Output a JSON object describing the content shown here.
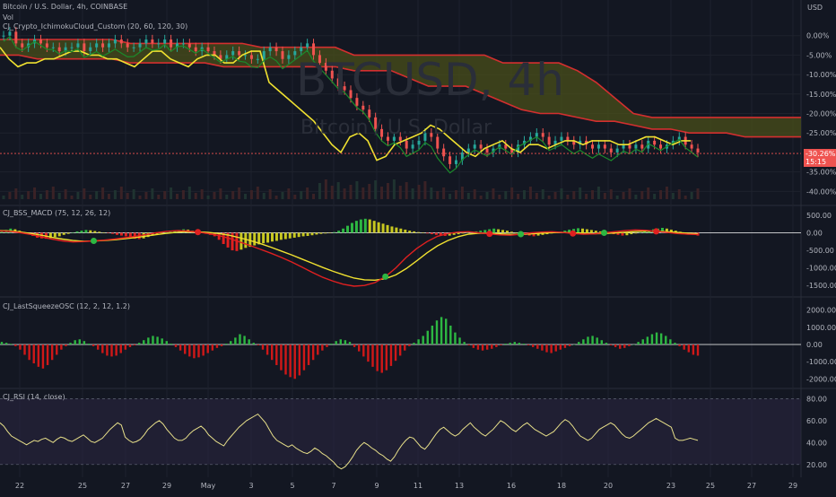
{
  "header": {
    "symbol": "Bitcoin / U.S. Dollar, 4h, COINBASE",
    "vol": "Vol",
    "ichimoku": "CJ_Crypto_IchimokuCloud_Custom (20, 60, 120, 30)",
    "macd": "CJ_BSS_MACD (75, 12, 26, 12)",
    "squeeze": "CJ_LastSqueezeOSC (12, 2, 12, 1.2)",
    "rsi": "CJ_RSI (14, close)"
  },
  "watermark": {
    "main": "BTCUSD, 4h",
    "sub": "Bitcoin / U.S. Dollar"
  },
  "currency_label": "USD",
  "last_price": {
    "value": "-30.26%",
    "timer": "15:15",
    "color": "#ef5350"
  },
  "colors": {
    "bg": "#131722",
    "grid": "#1e222d",
    "up": "#26a69a",
    "down": "#ef5350",
    "cloud": "#4a4f1a",
    "cloud_edge": "#d32f2f",
    "yellow": "#f0e130",
    "green": "#2db742",
    "red": "#e02020",
    "rsi_band": "#2a2540"
  },
  "chart_data": [
    {
      "type": "line",
      "title": "Bitcoin / U.S. Dollar, 4h, COINBASE",
      "x_ticks": [
        "22",
        "25",
        "27",
        "29",
        "May",
        "3",
        "5",
        "7",
        "9",
        "11",
        "13",
        "16",
        "18",
        "20",
        "23",
        "25",
        "27",
        "29"
      ],
      "y_unit": "%",
      "y_ticks": [
        "0.00%",
        "-5.00%",
        "-10.00%",
        "-15.00%",
        "-20.00%",
        "-25.00%",
        "-35.00%",
        "-40.00%"
      ],
      "ylim": [
        -42,
        5
      ],
      "series": [
        {
          "role": "price_close",
          "values": [
            0,
            1,
            -2,
            -3,
            -2,
            -1,
            -2,
            -3,
            -3,
            -4,
            -3,
            -3,
            -2,
            -4,
            -3,
            -2,
            -3,
            -2,
            -1,
            -2,
            -3,
            -3,
            -2,
            -1,
            -2,
            -2,
            -1,
            -3,
            -2,
            -2,
            -3,
            -4,
            -3,
            -4,
            -5,
            -6,
            -5,
            -4,
            -5,
            -5,
            -6,
            -6,
            -4,
            -3,
            -4,
            -6,
            -5,
            -4,
            -3,
            -2,
            -5,
            -7,
            -9,
            -11,
            -13,
            -14,
            -16,
            -18,
            -19,
            -21,
            -24,
            -26,
            -27,
            -26,
            -27,
            -29,
            -28,
            -27,
            -25,
            -26,
            -29,
            -31,
            -33,
            -32,
            -30,
            -29,
            -28,
            -29,
            -30,
            -29,
            -28,
            -29,
            -30,
            -28,
            -27,
            -26,
            -25,
            -26,
            -28,
            -27,
            -26,
            -27,
            -28,
            -27,
            -28,
            -29,
            -28,
            -29,
            -30,
            -29,
            -28,
            -29,
            -28,
            -29,
            -27,
            -28,
            -29,
            -28,
            -27,
            -26,
            -28,
            -29,
            -30
          ]
        },
        {
          "role": "lagging_yellow",
          "values": [
            -3,
            -6,
            -8,
            -7,
            -7,
            -6,
            -6,
            -5,
            -4,
            -4,
            -5,
            -5,
            -6,
            -6,
            -7,
            -8,
            -6,
            -4,
            -4,
            -6,
            -7,
            -8,
            -6,
            -5,
            -5,
            -7,
            -7,
            -5,
            -4,
            -4,
            -12,
            -14,
            -16,
            -18,
            -20,
            -22,
            -25,
            -28,
            -30,
            -26,
            -25,
            -27,
            -32,
            -31,
            -28,
            -27,
            -26,
            -25,
            -23,
            -24,
            -26,
            -28,
            -30,
            -31,
            -29,
            -28,
            -27,
            -29,
            -30,
            -28,
            -28,
            -29,
            -28,
            -27,
            -27,
            -28,
            -27,
            -27,
            -27,
            -28,
            -28,
            -27,
            -26,
            -26,
            -27,
            -28,
            -27,
            -27
          ]
        },
        {
          "role": "cloud_upper",
          "values": [
            -1,
            -1,
            -1,
            -1,
            -1,
            -1,
            -1,
            -2,
            -2,
            -2,
            -2,
            -2,
            -2,
            -2,
            -3,
            -3,
            -3,
            -3,
            -3,
            -5,
            -5,
            -5,
            -5,
            -5,
            -5,
            -5,
            -5,
            -7,
            -7,
            -7,
            -7,
            -9,
            -12,
            -16,
            -20,
            -21,
            -21,
            -21,
            -21,
            -21,
            -21,
            -21,
            -21,
            -21
          ]
        },
        {
          "role": "cloud_lower",
          "values": [
            -5,
            -5,
            -6,
            -6,
            -6,
            -6,
            -6,
            -7,
            -7,
            -7,
            -7,
            -7,
            -8,
            -8,
            -8,
            -8,
            -8,
            -8,
            -8,
            -9,
            -9,
            -9,
            -11,
            -13,
            -13,
            -13,
            -15,
            -17,
            -19,
            -20,
            -20,
            -21,
            -22,
            -22,
            -23,
            -24,
            -24,
            -25,
            -25,
            -25,
            -26,
            -26,
            -26,
            -26
          ]
        }
      ]
    },
    {
      "type": "bar",
      "title": "CJ_BSS_MACD (75, 12, 26, 12)",
      "y_ticks": [
        "500.00",
        "0.00",
        "-500.00",
        "-1000.00",
        "-1500.00"
      ],
      "ylim": [
        -1700,
        600
      ],
      "histogram": [
        50,
        80,
        120,
        100,
        60,
        20,
        -40,
        -90,
        -140,
        -160,
        -170,
        -150,
        -120,
        -100,
        -60,
        -30,
        10,
        40,
        60,
        80,
        70,
        50,
        30,
        10,
        -10,
        -30,
        -60,
        -80,
        -100,
        -140,
        -170,
        -180,
        -160,
        -120,
        -80,
        -40,
        -10,
        10,
        30,
        60,
        80,
        100,
        90,
        60,
        30,
        0,
        -30,
        -60,
        -100,
        -200,
        -320,
        -420,
        -500,
        -520,
        -480,
        -430,
        -400,
        -360,
        -330,
        -300,
        -280,
        -250,
        -230,
        -200,
        -180,
        -160,
        -140,
        -120,
        -100,
        -90,
        -70,
        -50,
        -30,
        -20,
        -10,
        20,
        60,
        120,
        200,
        280,
        340,
        380,
        400,
        380,
        340,
        300,
        260,
        220,
        180,
        150,
        120,
        90,
        60,
        40,
        20,
        0,
        -20,
        -40,
        -60,
        -80,
        -90,
        -80,
        -60,
        -40,
        -20,
        0,
        20,
        40,
        60,
        80,
        100,
        120,
        100,
        80,
        60,
        30,
        0,
        -30,
        -60,
        -80,
        -100,
        -80,
        -60,
        -40,
        -20,
        0,
        30,
        60,
        90,
        110,
        130,
        120,
        100,
        80,
        60,
        40,
        20,
        -20,
        -40,
        -60,
        -80,
        -70,
        -40,
        -20,
        10,
        40,
        70,
        100,
        120,
        140,
        120,
        90,
        60,
        30,
        0,
        -30,
        -60,
        -80
      ],
      "series": [
        {
          "role": "macd",
          "values": [
            50,
            40,
            0,
            -50,
            -120,
            -180,
            -230,
            -260,
            -250,
            -230,
            -210,
            -180,
            -140,
            -100,
            -50,
            0,
            40,
            60,
            50,
            20,
            -20,
            -80,
            -160,
            -260,
            -360,
            -470,
            -580,
            -700,
            -830,
            -980,
            -1130,
            -1270,
            -1380,
            -1470,
            -1520,
            -1500,
            -1420,
            -1250,
            -1000,
            -700,
            -450,
            -250,
            -100,
            -20,
            20,
            30,
            0,
            -30,
            -60,
            -70,
            -40,
            0,
            20,
            30,
            10,
            -20,
            -40,
            -30,
            0,
            30,
            60,
            80,
            70,
            40,
            10,
            -20,
            -40,
            -50
          ]
        },
        {
          "role": "signal",
          "values": [
            60,
            50,
            20,
            -20,
            -70,
            -130,
            -180,
            -220,
            -240,
            -235,
            -220,
            -200,
            -170,
            -135,
            -95,
            -55,
            -15,
            15,
            30,
            25,
            10,
            -20,
            -70,
            -140,
            -220,
            -310,
            -410,
            -520,
            -630,
            -750,
            -870,
            -990,
            -1100,
            -1200,
            -1290,
            -1340,
            -1350,
            -1310,
            -1200,
            -1020,
            -800,
            -570,
            -370,
            -220,
            -110,
            -40,
            -10,
            -15,
            -30,
            -45,
            -45,
            -30,
            -10,
            5,
            10,
            0,
            -15,
            -25,
            -20,
            -5,
            15,
            35,
            50,
            45,
            30,
            10,
            -10,
            -30
          ]
        }
      ]
    },
    {
      "type": "bar",
      "title": "CJ_LastSqueezeOSC (12, 2, 12, 1.2)",
      "y_ticks": [
        "2000.00",
        "1000.00",
        "0.00",
        "-1000.00",
        "-2000.00"
      ],
      "ylim": [
        -2300,
        2300
      ],
      "values": [
        150,
        100,
        40,
        -100,
        -300,
        -600,
        -900,
        -1100,
        -1300,
        -1400,
        -1200,
        -900,
        -600,
        -300,
        -100,
        100,
        250,
        300,
        200,
        50,
        -100,
        -300,
        -500,
        -650,
        -700,
        -650,
        -500,
        -300,
        -150,
        -50,
        100,
        250,
        400,
        500,
        450,
        350,
        200,
        50,
        -150,
        -350,
        -550,
        -700,
        -800,
        -750,
        -650,
        -500,
        -350,
        -200,
        -100,
        50,
        200,
        400,
        600,
        500,
        300,
        100,
        -50,
        -300,
        -600,
        -900,
        -1200,
        -1500,
        -1750,
        -1900,
        -2000,
        -1800,
        -1500,
        -1200,
        -900,
        -600,
        -350,
        -150,
        50,
        200,
        300,
        250,
        150,
        -150,
        -400,
        -700,
        -1000,
        -1300,
        -1550,
        -1650,
        -1500,
        -1250,
        -950,
        -650,
        -350,
        -100,
        100,
        300,
        500,
        800,
        1100,
        1400,
        1600,
        1500,
        1100,
        700,
        400,
        150,
        -50,
        -200,
        -300,
        -350,
        -300,
        -250,
        -150,
        -50,
        50,
        100,
        150,
        100,
        50,
        -50,
        -150,
        -250,
        -350,
        -450,
        -500,
        -400,
        -300,
        -200,
        -100,
        0,
        150,
        300,
        450,
        500,
        400,
        250,
        100,
        -50,
        -150,
        -250,
        -200,
        -100,
        0,
        150,
        300,
        450,
        600,
        700,
        650,
        500,
        300,
        100,
        -100,
        -300,
        -450,
        -600,
        -650
      ]
    },
    {
      "type": "line",
      "title": "CJ_RSI (14, close)",
      "y_ticks": [
        "80.00",
        "60.00",
        "40.00",
        "20.00"
      ],
      "ylim": [
        10,
        82
      ],
      "values": [
        58,
        55,
        50,
        46,
        44,
        42,
        40,
        38,
        40,
        42,
        41,
        43,
        44,
        42,
        40,
        43,
        45,
        44,
        42,
        41,
        43,
        45,
        47,
        44,
        41,
        40,
        42,
        44,
        48,
        52,
        55,
        58,
        56,
        45,
        42,
        40,
        41,
        43,
        47,
        52,
        55,
        58,
        60,
        57,
        52,
        48,
        44,
        42,
        42,
        44,
        48,
        51,
        53,
        55,
        52,
        47,
        44,
        41,
        39,
        37,
        42,
        46,
        50,
        54,
        57,
        60,
        62,
        64,
        66,
        62,
        58,
        52,
        46,
        42,
        40,
        38,
        36,
        38,
        35,
        33,
        31,
        30,
        32,
        35,
        33,
        30,
        28,
        25,
        22,
        18,
        16,
        18,
        22,
        27,
        33,
        37,
        40,
        38,
        35,
        33,
        30,
        28,
        25,
        23,
        27,
        33,
        38,
        42,
        45,
        44,
        40,
        36,
        34,
        38,
        43,
        48,
        52,
        54,
        51,
        48,
        46,
        48,
        52,
        55,
        58,
        54,
        51,
        48,
        46,
        49,
        52,
        56,
        60,
        58,
        55,
        52,
        50,
        53,
        56,
        58,
        55,
        52,
        50,
        48,
        46,
        48,
        50,
        54,
        58,
        61,
        59,
        55,
        50,
        46,
        44,
        42,
        44,
        48,
        52,
        54,
        56,
        58,
        56,
        52,
        48,
        45,
        44,
        46,
        49,
        52,
        55,
        58,
        60,
        62,
        60,
        58,
        56,
        54,
        44,
        42,
        42,
        43,
        44,
        43,
        42
      ]
    }
  ]
}
